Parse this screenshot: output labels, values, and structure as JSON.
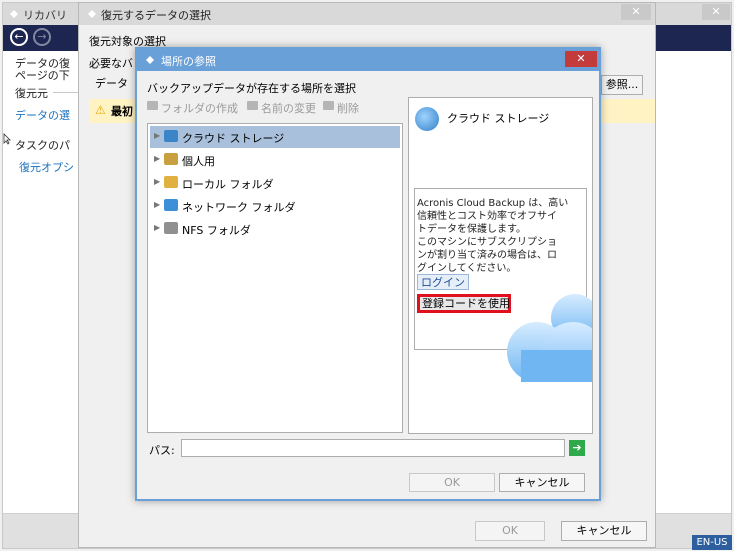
{
  "back_window": {
    "title": "リカバリ",
    "close_glyph": "✕",
    "nav_back": "←",
    "nav_forward": "→",
    "left": {
      "desc_line1": "データの復",
      "desc_line2": "ページの下",
      "source_label": "復元元",
      "data_link": "データの選",
      "task_icon": "cursor-icon",
      "task_label": "タスクのパ",
      "options_link": "復元オプシ"
    },
    "language": "EN-US"
  },
  "mid_window": {
    "title": "復元するデータの選択",
    "close_glyph": "✕",
    "section_title": "復元対象の選択",
    "hint": "必要なバ",
    "data_label": "データ",
    "browse_label": "参照...",
    "warning_text": "最初",
    "ok_label": "OK",
    "cancel_label": "キャンセル"
  },
  "dialog": {
    "title": "場所の参照",
    "close_glyph": "✕",
    "heading": "バックアップデータが存在する場所を選択",
    "toolbar": {
      "create_folder": "フォルダの作成",
      "rename": "名前の変更",
      "delete": "削除"
    },
    "tree": [
      {
        "label": "クラウド ストレージ",
        "icon": "cloud-icon",
        "color": "#3a85c8"
      },
      {
        "label": "個人用",
        "icon": "personal-folder-icon",
        "color": "#c8a040"
      },
      {
        "label": "ローカル フォルダ",
        "icon": "local-folder-icon",
        "color": "#e0b040"
      },
      {
        "label": "ネットワーク フォルダ",
        "icon": "network-folder-icon",
        "color": "#3d8fd8"
      },
      {
        "label": "NFS フォルダ",
        "icon": "nfs-folder-icon",
        "color": "#909090"
      }
    ],
    "cloud_panel": {
      "title": "クラウド ストレージ",
      "desc_lines": [
        "Acronis Cloud Backup は、高い",
        "信頼性とコスト効率でオフサイ",
        "トデータを保護します。",
        "このマシンにサブスクリプショ",
        "ンが割り当て済みの場合は、ロ",
        "グインしてください。"
      ],
      "login_label": "ログイン",
      "registration_code_label": "登録コードを使用"
    },
    "path_label": "パス:",
    "path_value": "",
    "ok_label": "OK",
    "cancel_label": "キャンセル"
  }
}
